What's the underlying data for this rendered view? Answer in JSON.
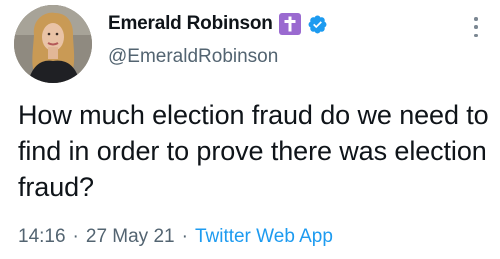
{
  "author": {
    "display_name": "Emerald Robinson",
    "handle": "@EmeraldRobinson",
    "badge_icon": "latin-cross-icon",
    "verified_icon": "verified-check-icon"
  },
  "tweet": {
    "text": "How much election fraud do we need to find in order to prove there was election fraud?",
    "time": "14:16",
    "date": "27 May 21",
    "separator": "·",
    "source": "Twitter Web App"
  },
  "actions": {
    "more_icon": "more-vertical-icon"
  },
  "colors": {
    "text": "#0f1419",
    "secondary": "#536471",
    "link": "#1d9bf0",
    "verified": "#1d9bf0",
    "cross_badge": "#9a6ad0"
  }
}
